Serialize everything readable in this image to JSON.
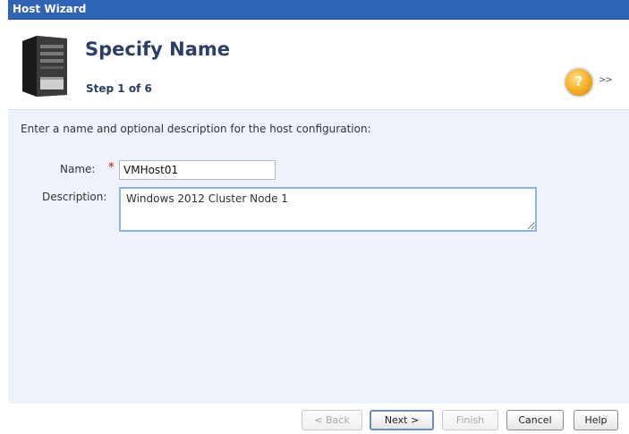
{
  "window": {
    "title": "Host Wizard"
  },
  "header": {
    "title": "Specify Name",
    "step": "Step 1 of 6",
    "help_icon": "question-mark-icon",
    "help_glyph": "?",
    "expand_glyph": ">>"
  },
  "form": {
    "prompt": "Enter a name and optional description for the host configuration:",
    "name_label": "Name:",
    "required_marker": "*",
    "name_value": "VMHost01",
    "description_label": "Description:",
    "description_value": "Windows 2012 Cluster Node 1"
  },
  "buttons": {
    "back": "< Back",
    "next": "Next >",
    "finish": "Finish",
    "cancel": "Cancel",
    "help": "Help"
  },
  "colors": {
    "title_bar": "#2f63b6",
    "content_bg": "#eef3fb",
    "required": "#d40000"
  }
}
